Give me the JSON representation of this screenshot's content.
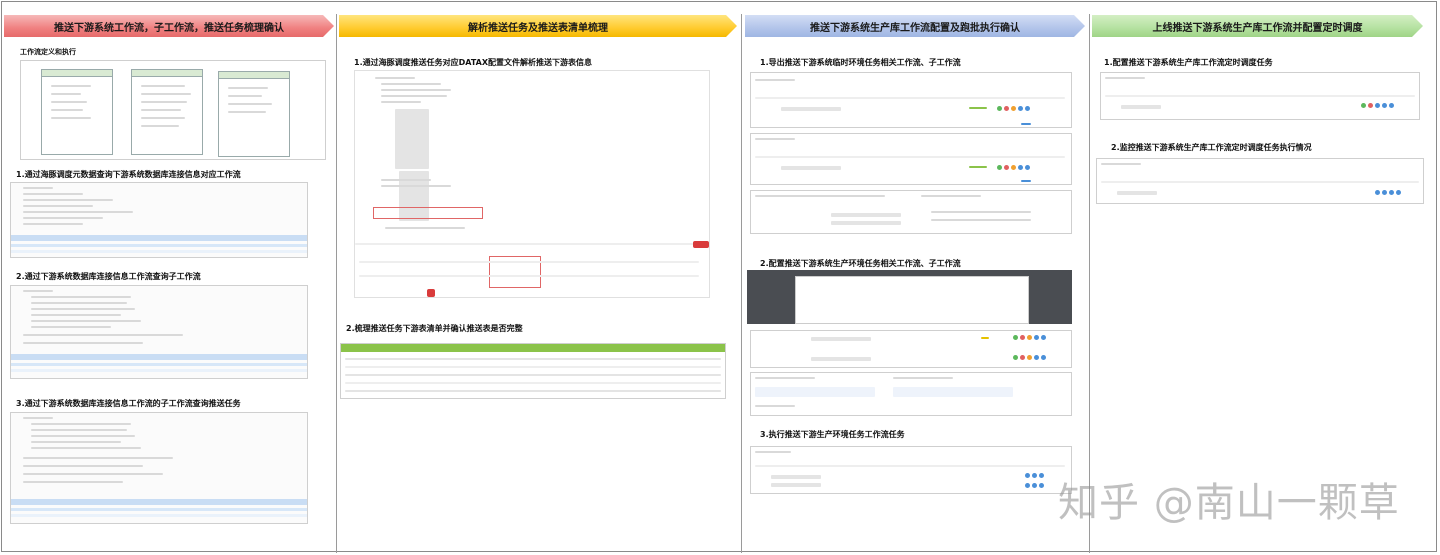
{
  "columns": [
    {
      "banner": "推送下游系统工作流，子工作流，推送任务梳理确认",
      "color": "#f08080",
      "steps": [
        "工作流定义和执行",
        "1.通过海豚调度元数据查询下游系统数据库连接信息对应工作流",
        "2.通过下游系统数据库连接信息工作流查询子工作流",
        "3.通过下游系统数据库连接信息工作流的子工作流查询推送任务"
      ]
    },
    {
      "banner": "解析推送任务及推送表清单梳理",
      "color": "#ffcb2e",
      "steps": [
        "1.通过海豚调度推送任务对应DATAX配置文件解析推送下游表信息",
        "2.梳理推送任务下游表清单并确认推送表是否完整"
      ]
    },
    {
      "banner": "推送下游系统生产库工作流配置及跑批执行确认",
      "color": "#b2c4ea",
      "steps": [
        "1.导出推送下游系统临时环境任务相关工作流、子工作流",
        "2.配置推送下游系统生产环境任务相关工作流、子工作流",
        "3.执行推送下游生产环境任务工作流任务"
      ]
    },
    {
      "banner": "上线推送下游系统生产库工作流并配置定时调度",
      "color": "#b4e1a0",
      "steps": [
        "1.配置推送下游系统生产库工作流定时调度任务",
        "2.监控推送下游系统生产库工作流定时调度任务执行情况"
      ]
    }
  ],
  "watermark": "知乎 @南山一颗草"
}
